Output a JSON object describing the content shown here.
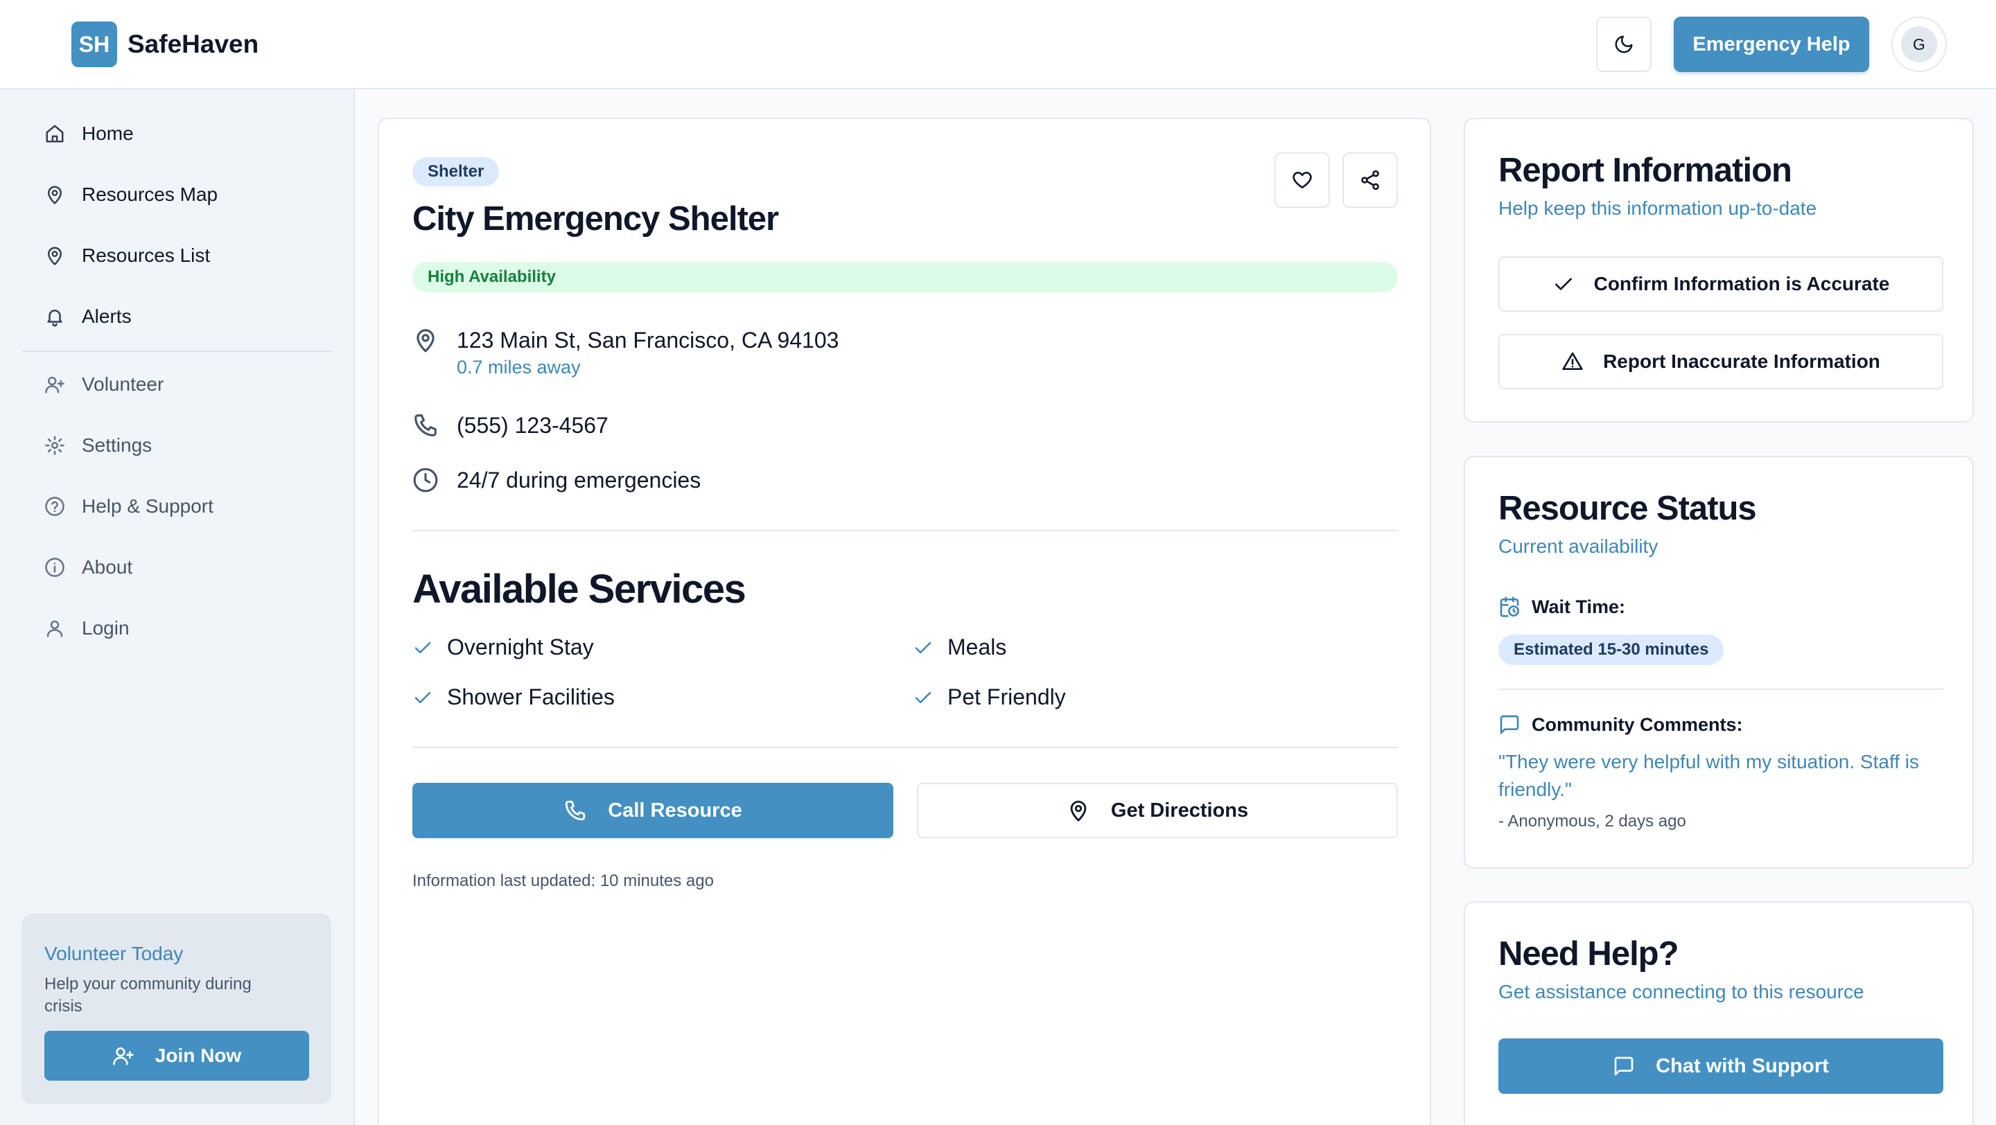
{
  "header": {
    "logo_initials": "SH",
    "app_name": "SafeHaven",
    "emergency_label": "Emergency Help",
    "avatar_initial": "G"
  },
  "sidebar": {
    "items": [
      {
        "label": "Home",
        "icon": "home-icon"
      },
      {
        "label": "Resources Map",
        "icon": "map-pin-icon"
      },
      {
        "label": "Resources List",
        "icon": "map-pin-icon"
      },
      {
        "label": "Alerts",
        "icon": "bell-icon"
      },
      {
        "label": "Volunteer",
        "icon": "user-plus-icon"
      },
      {
        "label": "Settings",
        "icon": "gear-icon"
      },
      {
        "label": "Help & Support",
        "icon": "help-circle-icon"
      },
      {
        "label": "About",
        "icon": "info-icon"
      },
      {
        "label": "Login",
        "icon": "user-icon"
      }
    ],
    "volunteer": {
      "title": "Volunteer Today",
      "description": "Help your community during crisis",
      "button_label": "Join Now"
    }
  },
  "resource": {
    "category": "Shelter",
    "name": "City Emergency Shelter",
    "availability": "High Availability",
    "address": "123 Main St, San Francisco, CA 94103",
    "distance": "0.7 miles away",
    "phone": "(555) 123-4567",
    "hours": "24/7 during emergencies",
    "services_title": "Available Services",
    "services": [
      "Overnight Stay",
      "Meals",
      "Shower Facilities",
      "Pet Friendly"
    ],
    "call_label": "Call Resource",
    "directions_label": "Get Directions",
    "last_updated": "Information last updated: 10 minutes ago"
  },
  "report": {
    "title": "Report Information",
    "subtitle": "Help keep this information up-to-date",
    "confirm_label": "Confirm Information is Accurate",
    "inaccurate_label": "Report Inaccurate Information"
  },
  "status": {
    "title": "Resource Status",
    "subtitle": "Current availability",
    "wait_label": "Wait Time:",
    "wait_value": "Estimated 15-30 minutes",
    "comments_label": "Community Comments:",
    "comment_text": "\"They were very helpful with my situation. Staff is friendly.\"",
    "comment_meta": "- Anonymous, 2 days ago"
  },
  "help": {
    "title": "Need Help?",
    "subtitle": "Get assistance connecting to this resource",
    "chat_label": "Chat with Support"
  },
  "colors": {
    "accent": "#4490c2",
    "success_bg": "#dcfce7",
    "success_text": "#15803d",
    "badge_bg": "#dbeafe"
  }
}
